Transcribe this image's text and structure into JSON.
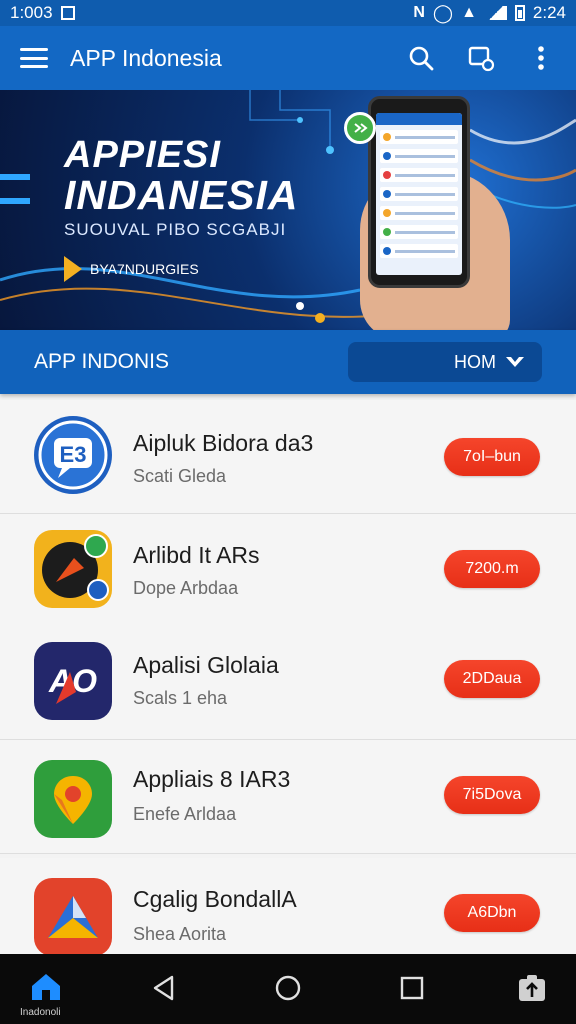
{
  "status_bar": {
    "time_left": "1:003",
    "time_right": "2:24"
  },
  "app_bar": {
    "title": "APP Indonesia",
    "icons": [
      "menu-icon",
      "search-icon",
      "device-icon",
      "more-vert-icon"
    ]
  },
  "banner": {
    "title_line1": "APPIESI",
    "title_line2": "INDANESIA",
    "subtitle": "SUOUVAL PIBO SCGABJI",
    "brand": "BYA7NDURGIES"
  },
  "section": {
    "title": "APP INDONIS",
    "button_label": "HOM"
  },
  "apps": [
    {
      "name": "Aipluk Bidora da3",
      "subtitle": "Scati Gleda",
      "button": "7oІ–bun",
      "icon": "chat-app-icon",
      "colors": [
        "#1e5fc0",
        "#ffffff"
      ]
    },
    {
      "name": "Arlibd It ARs",
      "subtitle": "Dope Arbdaa",
      "button": "7200.m",
      "icon": "sport-app-icon",
      "colors": [
        "#f2b21c",
        "#1c1c1c"
      ]
    },
    {
      "name": "Apalisi Glolaia",
      "subtitle": "Scals 1 eha",
      "button": "2DDaua",
      "icon": "ab-app-icon",
      "colors": [
        "#23276b",
        "#e43a2c"
      ]
    },
    {
      "name": "Appliais 8 IAR3",
      "subtitle": "Enefe Arldaa",
      "button": "7i5Dova",
      "icon": "maps-app-icon",
      "colors": [
        "#2f9e3c",
        "#f5b400"
      ]
    },
    {
      "name": "Cgalig BondallA",
      "subtitle": "Shea Aorita",
      "button": "A6Dbn",
      "icon": "drive-app-icon",
      "colors": [
        "#e2432b",
        "#2a6fd6"
      ]
    }
  ],
  "bottom_nav": {
    "home_label": "Inadonoli",
    "icons": [
      "home-icon",
      "back-icon",
      "circle-home-icon",
      "recents-icon",
      "share-icon"
    ]
  },
  "theme": {
    "primary": "#1368c4",
    "accent": "#ee3b22"
  }
}
